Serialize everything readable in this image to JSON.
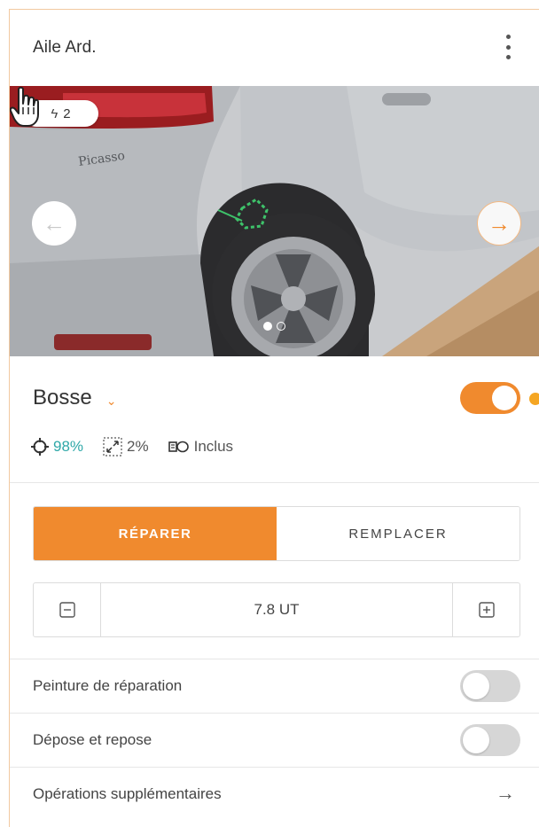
{
  "header": {
    "title": "Aile Ard."
  },
  "photo": {
    "badge_count": "2",
    "badge_icon": "bolt-icon",
    "prev_icon": "arrow-left-icon",
    "next_icon": "arrow-right-icon",
    "slide_count": 2,
    "active_slide": 0
  },
  "damage": {
    "name": "Bosse",
    "enabled": true,
    "stats": {
      "confidence": "98%",
      "size": "2%",
      "paint": "Inclus"
    }
  },
  "actions": {
    "repair_label": "RÉPARER",
    "replace_label": "REMPLACER",
    "selected": "repair"
  },
  "stepper": {
    "value": "7.8 UT"
  },
  "options": [
    {
      "label": "Peinture de réparation",
      "enabled": false
    },
    {
      "label": "Dépose et repose",
      "enabled": false
    },
    {
      "label": "Opérations supplémentaires"
    }
  ],
  "colors": {
    "accent": "#f08a2e",
    "teal": "#2fa8a8",
    "toggle_off": "#d6d6d6"
  }
}
